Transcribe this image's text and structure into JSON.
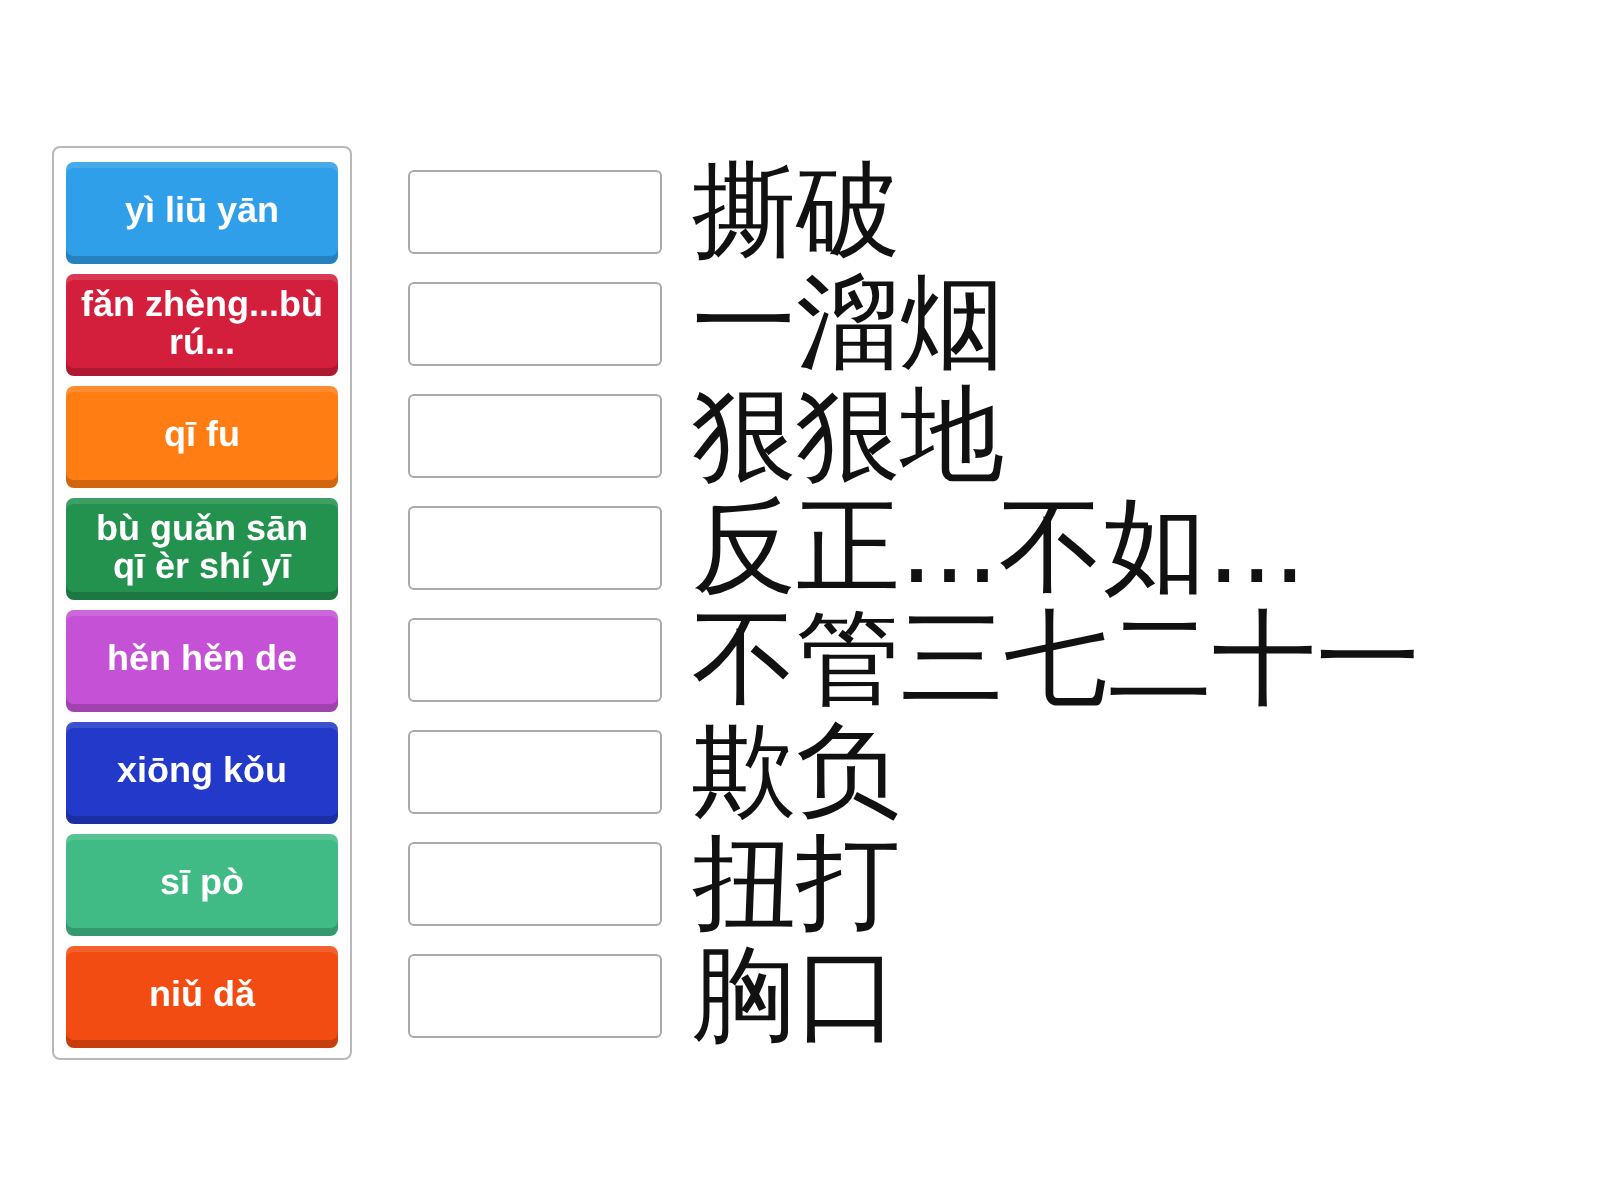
{
  "tiles": [
    {
      "text": "yì liū yān",
      "color": "#2f9fe9"
    },
    {
      "text": "fǎn zhèng...bù rú...",
      "color": "#d31f3c"
    },
    {
      "text": "qī fu",
      "color": "#ff7d12"
    },
    {
      "text": "bù guǎn sān qī èr shí yī",
      "color": "#23924f"
    },
    {
      "text": "hěn hěn de",
      "color": "#c552d6"
    },
    {
      "text": "xiōng kǒu",
      "color": "#2339c9"
    },
    {
      "text": "sī pò",
      "color": "#40bb85"
    },
    {
      "text": "niǔ dǎ",
      "color": "#f24c12"
    }
  ],
  "targets": [
    {
      "word": "撕破"
    },
    {
      "word": "一溜烟"
    },
    {
      "word": "狠狠地"
    },
    {
      "word": "反正...不如..."
    },
    {
      "word": "不管三七二十一"
    },
    {
      "word": "欺负"
    },
    {
      "word": "扭打"
    },
    {
      "word": "胸口"
    }
  ]
}
